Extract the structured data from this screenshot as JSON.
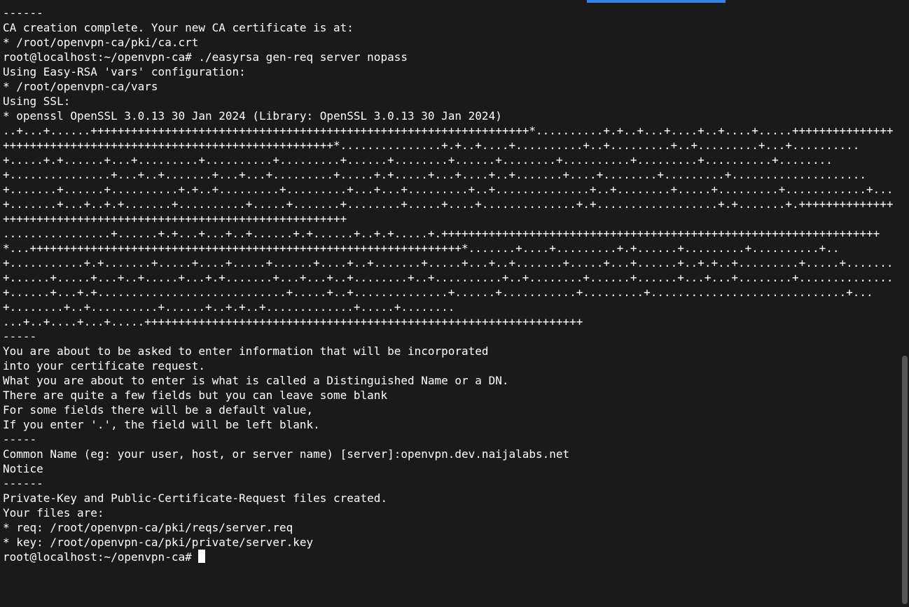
{
  "terminal": {
    "lines": [
      "------",
      "CA creation complete. Your new CA certificate is at:",
      "* /root/openvpn-ca/pki/ca.crt",
      "",
      "root@localhost:~/openvpn-ca# ./easyrsa gen-req server nopass",
      "Using Easy-RSA 'vars' configuration:",
      "* /root/openvpn-ca/vars",
      "",
      "Using SSL:",
      "* openssl OpenSSL 3.0.13 30 Jan 2024 (Library: OpenSSL 3.0.13 30 Jan 2024)",
      "..+...+......+++++++++++++++++++++++++++++++++++++++++++++++++++++++++++++++++*..........+.+..+...+....+..+....+.....++++++++++++++++++++++++++++++++++++++++++++++++++++++++++++++++*...............+.+..+....+..........+..+.........+..+.........+...+..........+.....+.+......+...+.........+..........+.........+......+........+......+........+..........+.........+..........+........+...............+...+..+.......+...+...+.........+.....+.+.....+...+....+..+.......+....+........+.........+....................+.......+......+..........+.+..+.........+.........+...+...+.........+..+..............+..+........+.....+.........+............+...+.......+...+..+.+.......+..........+.....+.......+........+.....+....+..............+.+..................+.+.......+.+++++++++++++++++++++++++++++++++++++++++++++++++++++++++++++++++",
      "................+......+.+...+...+..+......+.+......+..+.+.....+.+++++++++++++++++++++++++++++++++++++++++++++++++++++++++++++++++*...++++++++++++++++++++++++++++++++++++++++++++++++++++++++++++++++*.......+....+.........+.+......+.........+..........+..+...........+.+.......+.....+....+.....+......+....+..+.......+.....+...+..+.......+.....+...+......+..+.+..+.........+.....+.......+......+.....+...+..+.....+...+.+.......+...+...+..+........+..+..........+..+........+......+......+...+...+........+..............+......+...+.+............................+.....+..+..............+......+...........+.........+.............................+...+........+..+..........+......+..+.+..+.............+.....+........",
      "...+..+....+...+.....+++++++++++++++++++++++++++++++++++++++++++++++++++++++++++++++++",
      "-----",
      "You are about to be asked to enter information that will be incorporated",
      "into your certificate request.",
      "What you are about to enter is what is called a Distinguished Name or a DN.",
      "There are quite a few fields but you can leave some blank",
      "For some fields there will be a default value,",
      "If you enter '.', the field will be left blank.",
      "-----",
      "Common Name (eg: your user, host, or server name) [server]:openvpn.dev.naijalabs.net",
      "",
      "Notice",
      "------",
      "Private-Key and Public-Certificate-Request files created.",
      "Your files are:",
      "* req: /root/openvpn-ca/pki/reqs/server.req",
      "* key: /root/openvpn-ca/pki/private/server.key",
      "",
      "root@localhost:~/openvpn-ca# "
    ]
  }
}
